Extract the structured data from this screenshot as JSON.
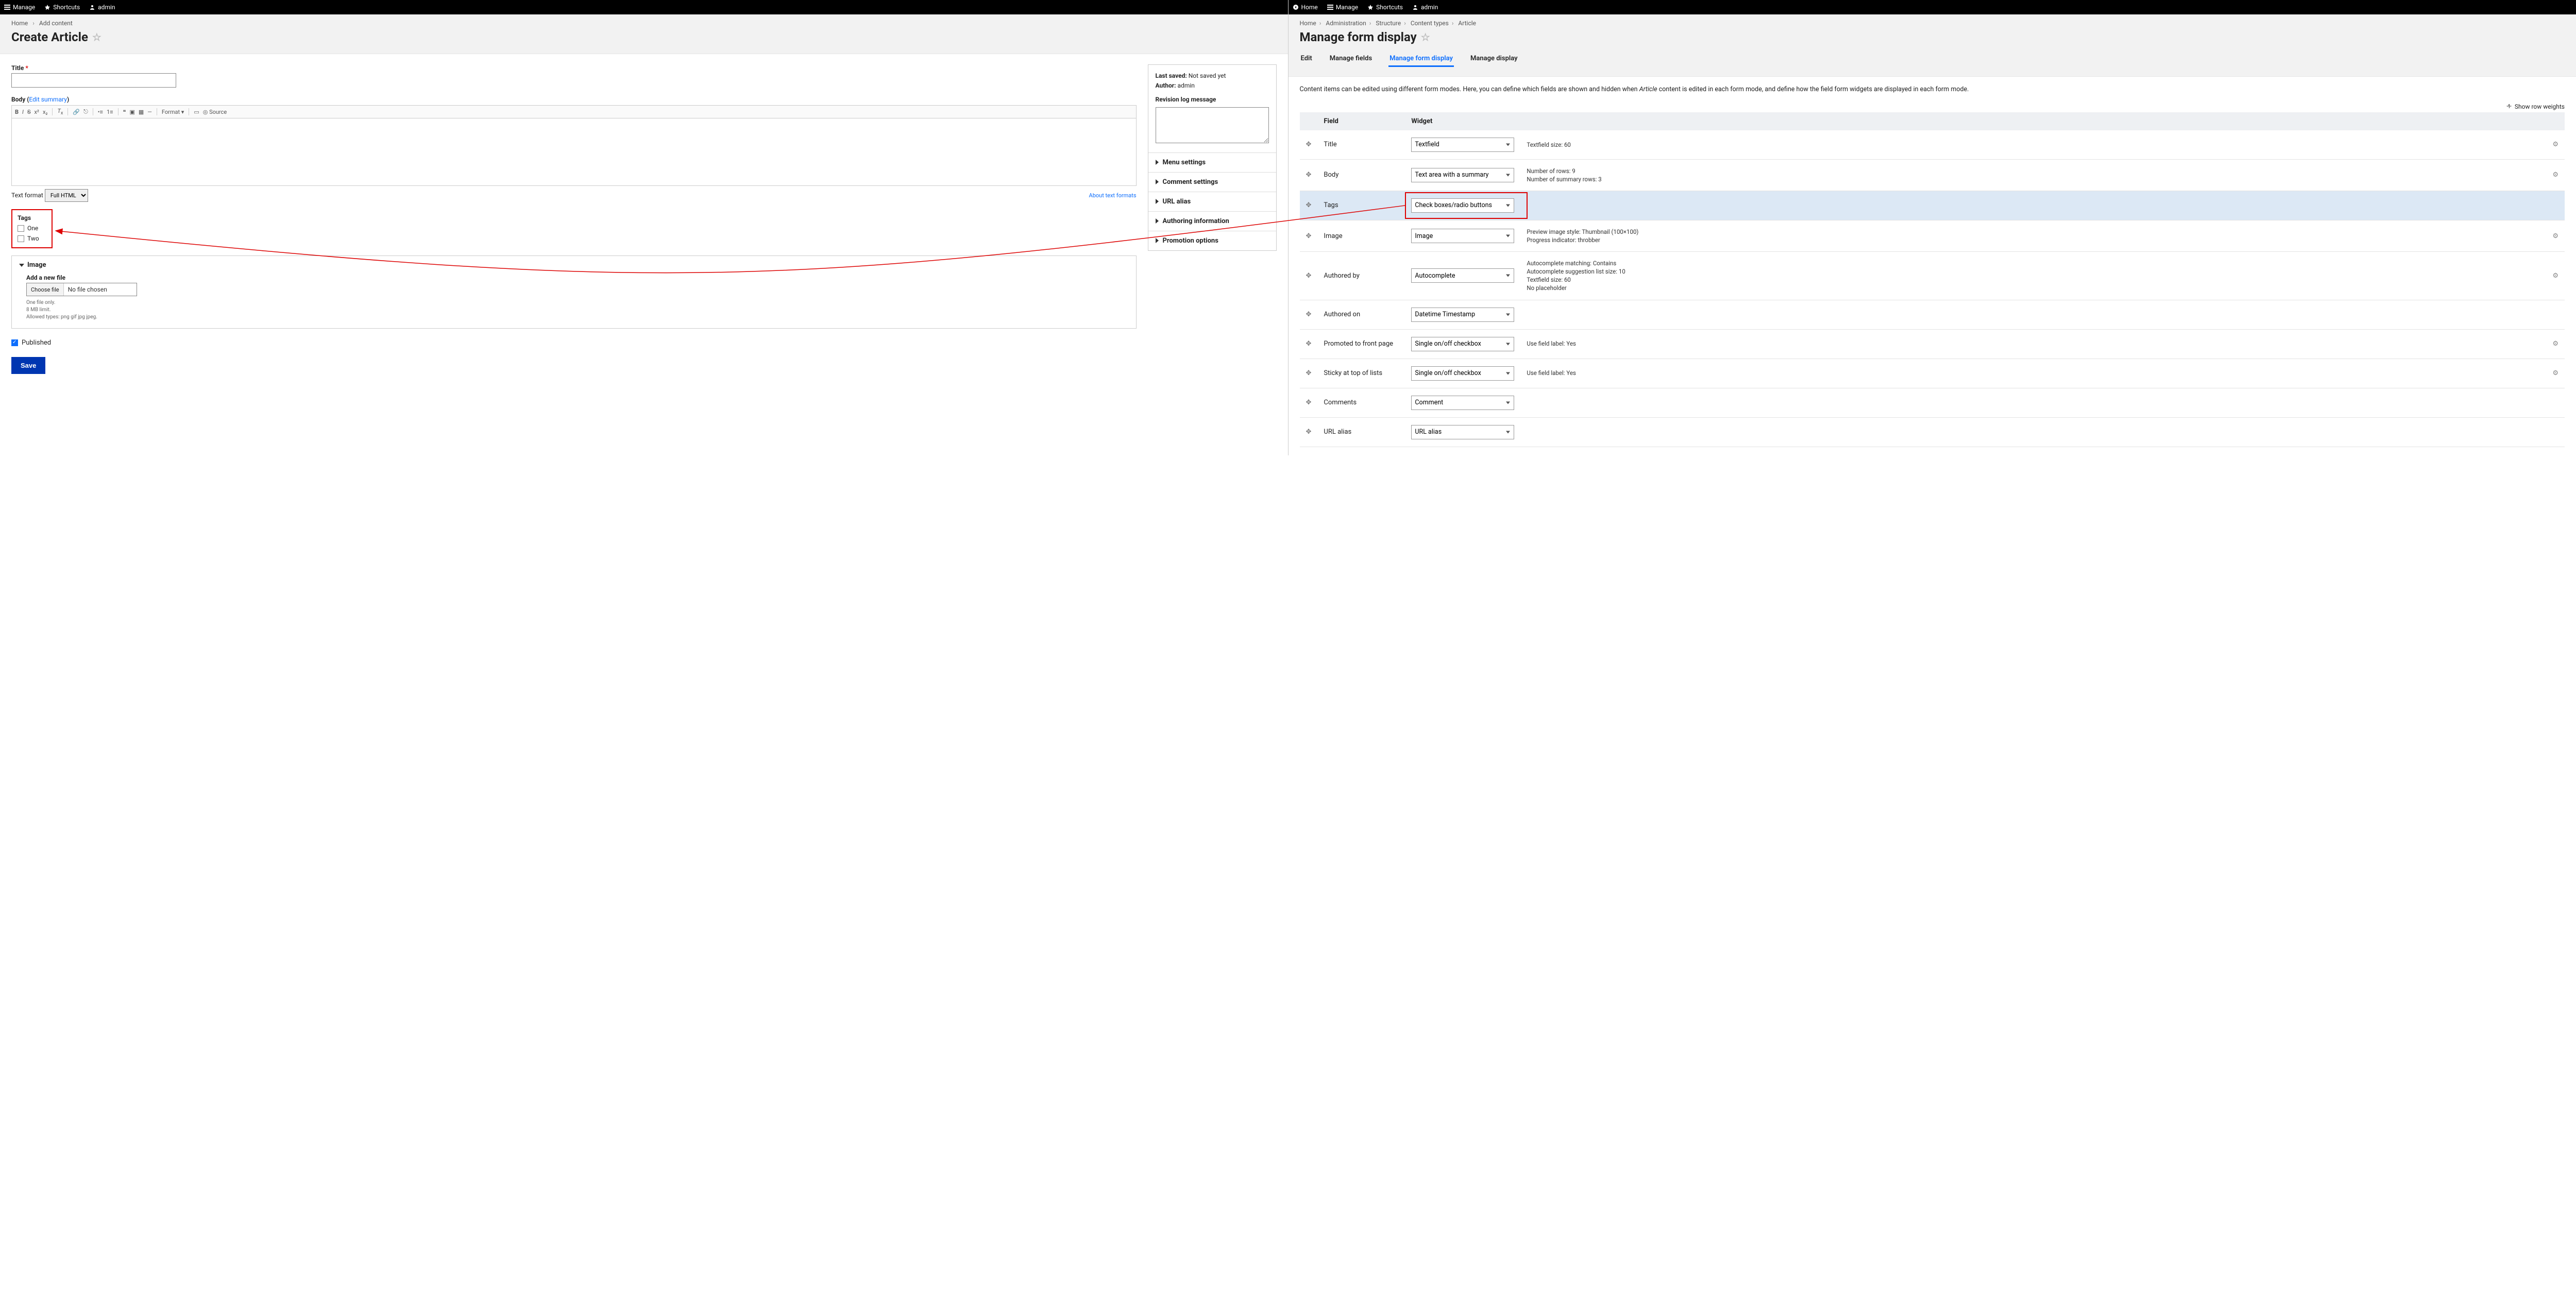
{
  "left": {
    "topbar": {
      "manage": "Manage",
      "shortcuts": "Shortcuts",
      "user": "admin"
    },
    "breadcrumb": [
      "Home",
      "Add content"
    ],
    "title": "Create Article",
    "title_label": "Title",
    "body_label": "Body",
    "edit_summary": "Edit summary",
    "toolbar": {
      "format": "Format",
      "source_label": "Source"
    },
    "textformat_label": "Text format",
    "textformat_value": "Full HTML",
    "about_formats": "About text formats",
    "tags": {
      "label": "Tags",
      "options": [
        "One",
        "Two"
      ]
    },
    "image": {
      "head": "Image",
      "add_label": "Add a new file",
      "choose": "Choose file",
      "nofile": "No file chosen",
      "hints": [
        "One file only.",
        "8 MB limit.",
        "Allowed types: png gif jpg jpeg."
      ]
    },
    "published": "Published",
    "save": "Save",
    "side": {
      "last_saved_label": "Last saved:",
      "last_saved_value": "Not saved yet",
      "author_label": "Author:",
      "author_value": "admin",
      "revlog": "Revision log message",
      "acc": [
        "Menu settings",
        "Comment settings",
        "URL alias",
        "Authoring information",
        "Promotion options"
      ]
    }
  },
  "right": {
    "topbar": {
      "home": "Home",
      "manage": "Manage",
      "shortcuts": "Shortcuts",
      "user": "admin"
    },
    "breadcrumb": [
      "Home",
      "Administration",
      "Structure",
      "Content types",
      "Article"
    ],
    "title": "Manage form display",
    "tabs": [
      "Edit",
      "Manage fields",
      "Manage form display",
      "Manage display"
    ],
    "active_tab": "Manage form display",
    "helptext_a": "Content items can be edited using different form modes. Here, you can define which fields are shown and hidden when ",
    "helptext_em": "Article",
    "helptext_b": " content is edited in each form mode, and define how the field form widgets are displayed in each form mode.",
    "show_weights": "Show row weights",
    "cols": {
      "field": "Field",
      "widget": "Widget"
    },
    "rows": [
      {
        "field": "Title",
        "widget": "Textfield",
        "summary": "Textfield size: 60",
        "gear": true
      },
      {
        "field": "Body",
        "widget": "Text area with a summary",
        "summary": "Number of rows: 9\nNumber of summary rows: 3",
        "gear": true
      },
      {
        "field": "Tags",
        "widget": "Check boxes/radio buttons",
        "summary": "",
        "gear": false,
        "highlight": true
      },
      {
        "field": "Image",
        "widget": "Image",
        "summary": "Preview image style: Thumbnail (100×100)\nProgress indicator: throbber",
        "gear": true
      },
      {
        "field": "Authored by",
        "widget": "Autocomplete",
        "summary": "Autocomplete matching: Contains\nAutocomplete suggestion list size: 10\nTextfield size: 60\nNo placeholder",
        "gear": true
      },
      {
        "field": "Authored on",
        "widget": "Datetime Timestamp",
        "summary": "",
        "gear": false
      },
      {
        "field": "Promoted to front page",
        "widget": "Single on/off checkbox",
        "summary": "Use field label: Yes",
        "gear": true
      },
      {
        "field": "Sticky at top of lists",
        "widget": "Single on/off checkbox",
        "summary": "Use field label: Yes",
        "gear": true
      },
      {
        "field": "Comments",
        "widget": "Comment",
        "summary": "",
        "gear": false
      },
      {
        "field": "URL alias",
        "widget": "URL alias",
        "summary": "",
        "gear": false
      }
    ]
  }
}
